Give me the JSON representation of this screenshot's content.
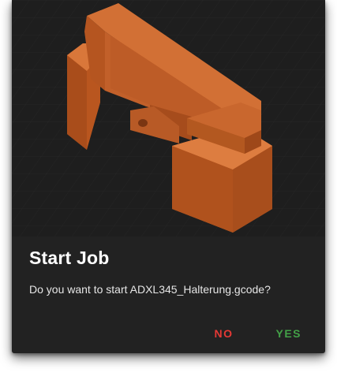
{
  "dialog": {
    "title": "Start Job",
    "message": "Do you want to start ADXL345_Halterung.gcode?",
    "no_label": "NO",
    "yes_label": "YES"
  },
  "thumbnail": {
    "icon": "gcode-model-preview",
    "model_color": "#c8652a"
  }
}
